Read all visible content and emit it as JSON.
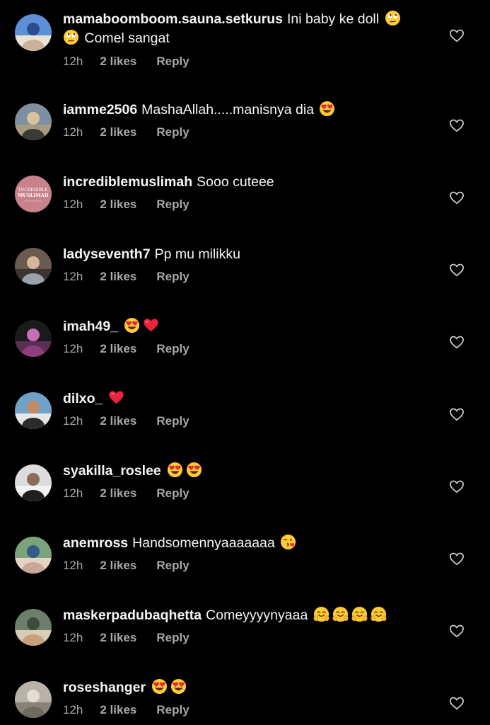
{
  "colors": {
    "background": "#000000",
    "text_primary": "#f5f5f5",
    "text_secondary": "#a8a8a8"
  },
  "comments": [
    {
      "username": "mamaboomboom.sauna.setkurus",
      "text_a": "Ini baby ke doll",
      "emoji_a": [
        "face-with-rolling-eyes"
      ],
      "text_b": "Comel sangat",
      "emoji_b_lead": [
        "face-with-rolling-eyes"
      ],
      "time": "12h",
      "likes": "2 likes",
      "reply": "Reply",
      "avatar_icon": "avatar-photo"
    },
    {
      "username": "iamme2506",
      "text_a": "MashaAllah.....manisnya dia",
      "emoji_a": [
        "smiling-face-with-heart-eyes"
      ],
      "time": "12h",
      "likes": "2 likes",
      "reply": "Reply",
      "avatar_icon": "avatar-photo"
    },
    {
      "username": "incrediblemuslimah",
      "text_a": "Sooo cuteee",
      "emoji_a": [],
      "time": "12h",
      "likes": "2 likes",
      "reply": "Reply",
      "avatar_icon": "avatar-logo"
    },
    {
      "username": "ladyseventh7",
      "text_a": "Pp mu milikku",
      "emoji_a": [],
      "time": "12h",
      "likes": "2 likes",
      "reply": "Reply",
      "avatar_icon": "avatar-photo"
    },
    {
      "username": "imah49_",
      "text_a": "",
      "emoji_a": [
        "smiling-face-with-heart-eyes",
        "red-heart"
      ],
      "time": "12h",
      "likes": "2 likes",
      "reply": "Reply",
      "avatar_icon": "avatar-photo"
    },
    {
      "username": "dilxo_",
      "text_a": "",
      "emoji_a": [
        "red-heart"
      ],
      "time": "12h",
      "likes": "2 likes",
      "reply": "Reply",
      "avatar_icon": "avatar-photo"
    },
    {
      "username": "syakilla_roslee",
      "text_a": "",
      "emoji_a": [
        "smiling-face-with-heart-eyes",
        "smiling-face-with-heart-eyes"
      ],
      "time": "12h",
      "likes": "2 likes",
      "reply": "Reply",
      "avatar_icon": "avatar-photo"
    },
    {
      "username": "anemross",
      "text_a": "Handsomennyaaaaaaa",
      "emoji_a": [
        "face-blowing-a-kiss"
      ],
      "time": "12h",
      "likes": "2 likes",
      "reply": "Reply",
      "avatar_icon": "avatar-photo"
    },
    {
      "username": "maskerpadubaqhetta",
      "text_a": "Comeyyyynyaaa",
      "emoji_a": [
        "hugging-face",
        "hugging-face",
        "hugging-face",
        "hugging-face"
      ],
      "time": "12h",
      "likes": "2 likes",
      "reply": "Reply",
      "avatar_icon": "avatar-photo"
    },
    {
      "username": "roseshanger",
      "text_a": "",
      "emoji_a": [
        "smiling-face-with-heart-eyes",
        "smiling-face-with-heart-eyes"
      ],
      "time": "12h",
      "likes": "2 likes",
      "reply": "Reply",
      "avatar_icon": "avatar-photo"
    }
  ],
  "logo_text": {
    "line1": "INCREDIBLE",
    "line2": "MUSLIMAH"
  }
}
